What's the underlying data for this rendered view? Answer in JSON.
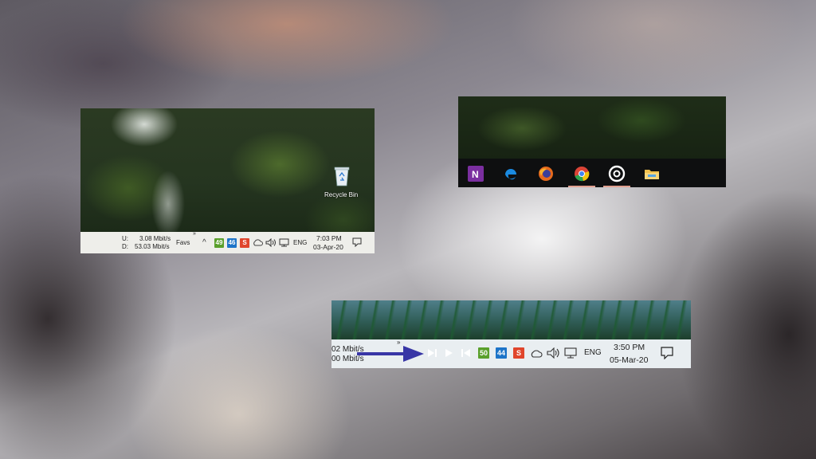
{
  "panel_a": {
    "desktop": {
      "recycle_bin_label": "Recycle Bin"
    },
    "net_meter": {
      "upload_label": "U:",
      "upload_value": "3.08 Mbit/s",
      "download_label": "D:",
      "download_value": "53.03 Mbit/s"
    },
    "toolbar_overflow": "»",
    "favs_label": "Favs",
    "tray": {
      "chevron": "^",
      "badge_green": "49",
      "badge_blue": "46",
      "badge_red": "S",
      "language": "ENG"
    },
    "clock": {
      "time": "7:03 PM",
      "date": "03-Apr-20"
    }
  },
  "panel_b": {
    "taskbar_apps": [
      "onenote-icon",
      "edge-icon",
      "firefox-icon",
      "chrome-icon",
      "groove-icon",
      "file-explorer-icon"
    ]
  },
  "panel_c": {
    "net_meter": {
      "line1": "02 Mbit/s",
      "line2": "00 Mbit/s"
    },
    "toolbar_overflow": "»",
    "tray": {
      "badge_green": "50",
      "badge_blue": "44",
      "badge_red": "S",
      "language": "ENG"
    },
    "clock": {
      "time": "3:50 PM",
      "date": "05-Mar-20"
    }
  },
  "colors": {
    "badge_green": "#5aa02c",
    "badge_blue": "#1d74c8",
    "badge_red": "#e0452c",
    "arrow": "#3836a6"
  }
}
